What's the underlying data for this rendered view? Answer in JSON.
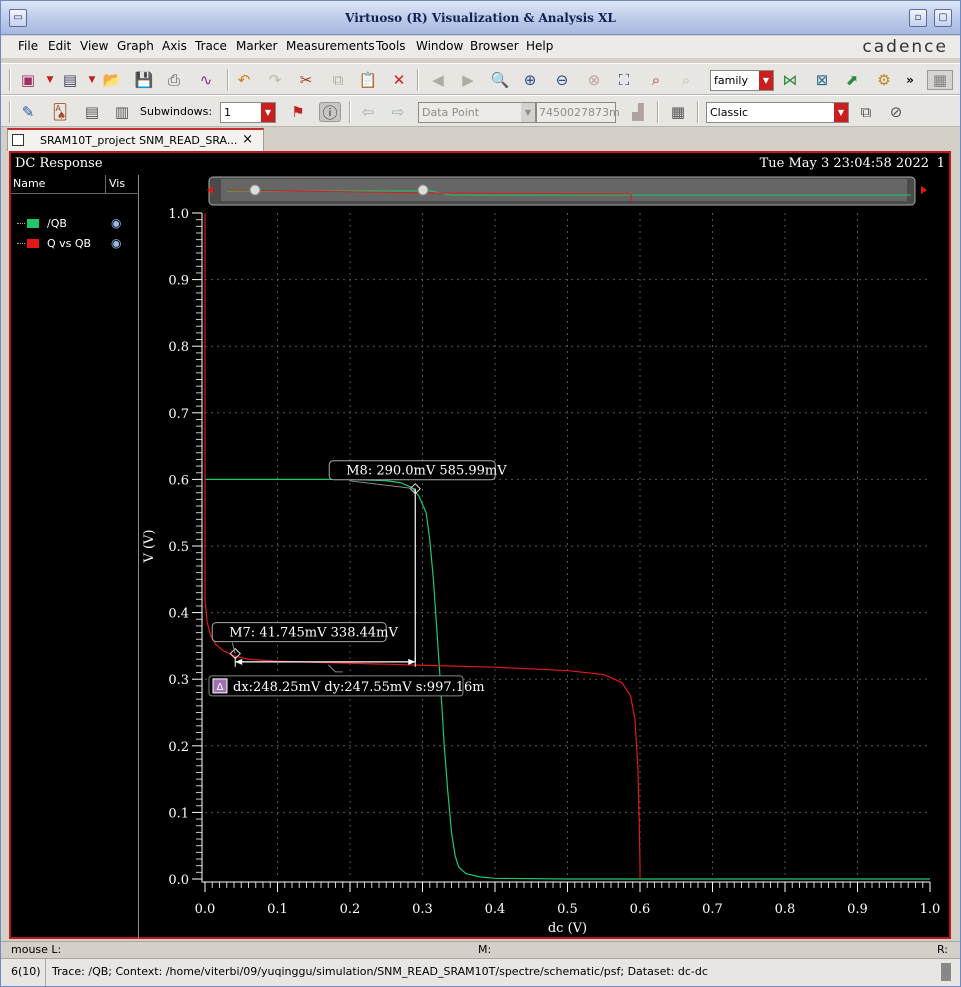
{
  "window": {
    "title": "Virtuoso (R) Visualization & Analysis XL",
    "brand": "cadence"
  },
  "menubar": {
    "items": [
      "File",
      "Edit",
      "View",
      "Graph",
      "Axis",
      "Trace",
      "Marker",
      "Measurements",
      "Tools",
      "Window",
      "Browser",
      "Help"
    ]
  },
  "toolbar1": {
    "family_value": "family"
  },
  "toolbar2": {
    "subwindows_label": "Subwindows:",
    "subwindows_value": "1",
    "datapoint_value": "Data Point",
    "datapoint_readout": "7450027873m",
    "style_value": "Classic"
  },
  "tab": {
    "label": "SRAM10T_project SNM_READ_SRA...",
    "close": "×"
  },
  "plot": {
    "header_title": "DC Response",
    "timestamp": "Tue May 3 23:04:58 2022",
    "subwindow_number": "1",
    "legend_header_name": "Name",
    "legend_header_vis": "Vis",
    "traces": [
      {
        "name": "/QB",
        "color": "#1ec86a"
      },
      {
        "name": "Q vs QB",
        "color": "#e01818"
      }
    ]
  },
  "chart_data": {
    "type": "line",
    "title": "",
    "xlabel": "dc (V)",
    "ylabel": "V (V)",
    "xlim": [
      0.0,
      1.0
    ],
    "ylim": [
      0.0,
      1.0
    ],
    "xticks": [
      "0.0",
      "0.1",
      "0.2",
      "0.3",
      "0.4",
      "0.5",
      "0.6",
      "0.7",
      "0.8",
      "0.9",
      "1.0"
    ],
    "yticks": [
      "0.0",
      "0.1",
      "0.2",
      "0.3",
      "0.4",
      "0.5",
      "0.6",
      "0.7",
      "0.8",
      "0.9",
      "1.0"
    ],
    "grid": true,
    "series": [
      {
        "name": "/QB",
        "color": "#1ec86a",
        "x": [
          0.0,
          0.1,
          0.2,
          0.25,
          0.27,
          0.285,
          0.295,
          0.305,
          0.31,
          0.315,
          0.32,
          0.325,
          0.33,
          0.335,
          0.34,
          0.345,
          0.35,
          0.36,
          0.38,
          0.4,
          0.5,
          0.6,
          0.8,
          1.0
        ],
        "y": [
          0.6,
          0.6,
          0.6,
          0.598,
          0.595,
          0.588,
          0.575,
          0.55,
          0.51,
          0.45,
          0.37,
          0.29,
          0.2,
          0.13,
          0.07,
          0.035,
          0.018,
          0.008,
          0.003,
          0.001,
          0.0,
          0.0,
          0.0,
          0.0
        ]
      },
      {
        "name": "Q vs QB",
        "color": "#e01818",
        "x": [
          0.0,
          0.0,
          0.0,
          0.003,
          0.008,
          0.015,
          0.025,
          0.04,
          0.06,
          0.1,
          0.2,
          0.3,
          0.4,
          0.5,
          0.55,
          0.575,
          0.587,
          0.593,
          0.597,
          0.599,
          0.6,
          0.6
        ],
        "y": [
          1.0,
          0.6,
          0.42,
          0.385,
          0.365,
          0.352,
          0.343,
          0.335,
          0.33,
          0.327,
          0.324,
          0.321,
          0.318,
          0.313,
          0.307,
          0.295,
          0.275,
          0.24,
          0.17,
          0.08,
          0.02,
          0.0
        ]
      }
    ],
    "markers": [
      {
        "id": "M8",
        "label": "M8: 290.0mV 585.99mV",
        "x": 0.29,
        "y": 0.586
      },
      {
        "id": "M7",
        "label": "M7: 41.745mV 338.44mV",
        "x": 0.0417,
        "y": 0.3384
      }
    ],
    "delta": {
      "label": "dx:248.25mV dy:247.55mV s:997.16m",
      "x1": 0.0417,
      "x2": 0.29,
      "y": 0.326
    }
  },
  "status": {
    "mouse_left": "mouse L:",
    "mouse_mid": "M:",
    "mouse_right": "R:",
    "count": "6(10)",
    "message": "Trace: /QB; Context: /home/viterbi/09/yuqinggu/simulation/SNM_READ_SRAM10T/spectre/schematic/psf; Dataset: dc-dc"
  }
}
